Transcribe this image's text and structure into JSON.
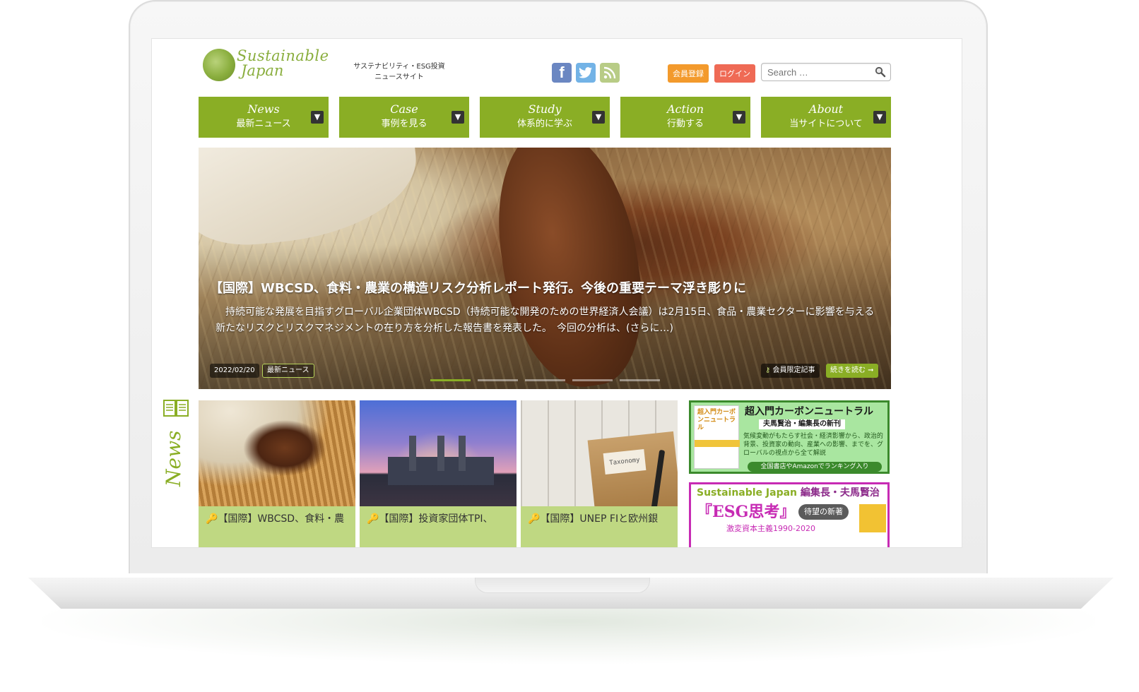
{
  "site": {
    "logo_line1": "Sustainable",
    "logo_line2": "Japan",
    "tagline_line1": "サステナビリティ・ESG投資",
    "tagline_line2": "ニュースサイト"
  },
  "header": {
    "register_label": "会員登録",
    "login_label": "ログイン",
    "search_placeholder": "Search …",
    "social": [
      "facebook-icon",
      "twitter-icon",
      "rss-icon"
    ]
  },
  "nav": [
    {
      "en": "News",
      "ja": "最新ニュース"
    },
    {
      "en": "Case",
      "ja": "事例を見る"
    },
    {
      "en": "Study",
      "ja": "体系的に学ぶ"
    },
    {
      "en": "Action",
      "ja": "行動する"
    },
    {
      "en": "About",
      "ja": "当サイトについて"
    }
  ],
  "hero": {
    "title": "【国際】WBCSD、食料・農業の構造リスク分析レポート発行。今後の重要テーマ浮き彫りに",
    "description": "持続可能な発展を目指すグローバル企業団体WBCSD（持続可能な開発のための世界経済人会議）は2月15日、食品・農業セクターに影響を与える新たなリスクとリスクマネジメントの在り方を分析した報告書を発表した。　今回の分析は、(さらに…)",
    "date": "2022/02/20",
    "category": "最新ニュース",
    "member_label": "会員限定記事",
    "read_more": "続きを読む ➞",
    "slide_count": 5,
    "active_slide": 1
  },
  "news": {
    "section_label": "News",
    "cards": [
      {
        "caption": "【国際】WBCSD、食料・農"
      },
      {
        "caption": "【国際】投資家団体TPI、"
      },
      {
        "caption": "【国際】UNEP FIと欧州銀"
      }
    ],
    "card3_tag": "Taxonomy"
  },
  "ads": {
    "ad1": {
      "book_title": "超入門カーボンニュートラル",
      "title": "超入門カーボンニュートラル",
      "subtitle": "夫馬賢治・編集長の新刊",
      "description": "気候変動がもたらす社会・経済影響から、政治的背景、投資家の動向、産業への影響、までを、グローバルの視点から全て解説",
      "footer": "全国書店やAmazonでランキング入り"
    },
    "ad2": {
      "top_brand": "Sustainable Japan",
      "top_rest": " 編集長・夫馬賢治",
      "title": "『ESG思考』",
      "badge": "待望の新著",
      "subtitle": "激変資本主義1990-2020"
    }
  },
  "colors": {
    "brand_green": "#8aae25",
    "register_orange": "#f39a2c",
    "login_red": "#ef6a55",
    "ad1_border": "#3b8a2c",
    "ad2_magenta": "#c72bb4"
  }
}
